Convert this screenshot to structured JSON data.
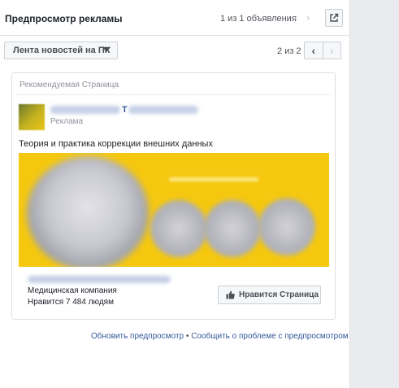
{
  "header": {
    "title": "Предпросмотр рекламы",
    "ad_counter": "1 из 1 объявления",
    "prev_arrow": "‹",
    "next_arrow": "›",
    "external_icon": "external-link-icon"
  },
  "placement": {
    "selected": "Лента новостей на ПК",
    "page_counter": "2 из 2",
    "prev": "‹",
    "next": "›"
  },
  "ad": {
    "recommended_label": "Рекомендуемая Страница",
    "page_name_visible": "Т",
    "sponsored": "Реклама",
    "text": "Теория и практика коррекции внешних данных",
    "category": "Медицинская компания",
    "likes": "Нравится 7 484 людям",
    "like_button": "Нравится Страница",
    "like_icon": "thumbs-up-icon"
  },
  "footer": {
    "refresh": "Обновить предпросмотр",
    "separator": "•",
    "report": "Сообщить о проблеме с предпросмотром"
  },
  "colors": {
    "accent": "#365899",
    "creative_bg": "#f5c80f",
    "page_bg": "#e9ebee"
  }
}
